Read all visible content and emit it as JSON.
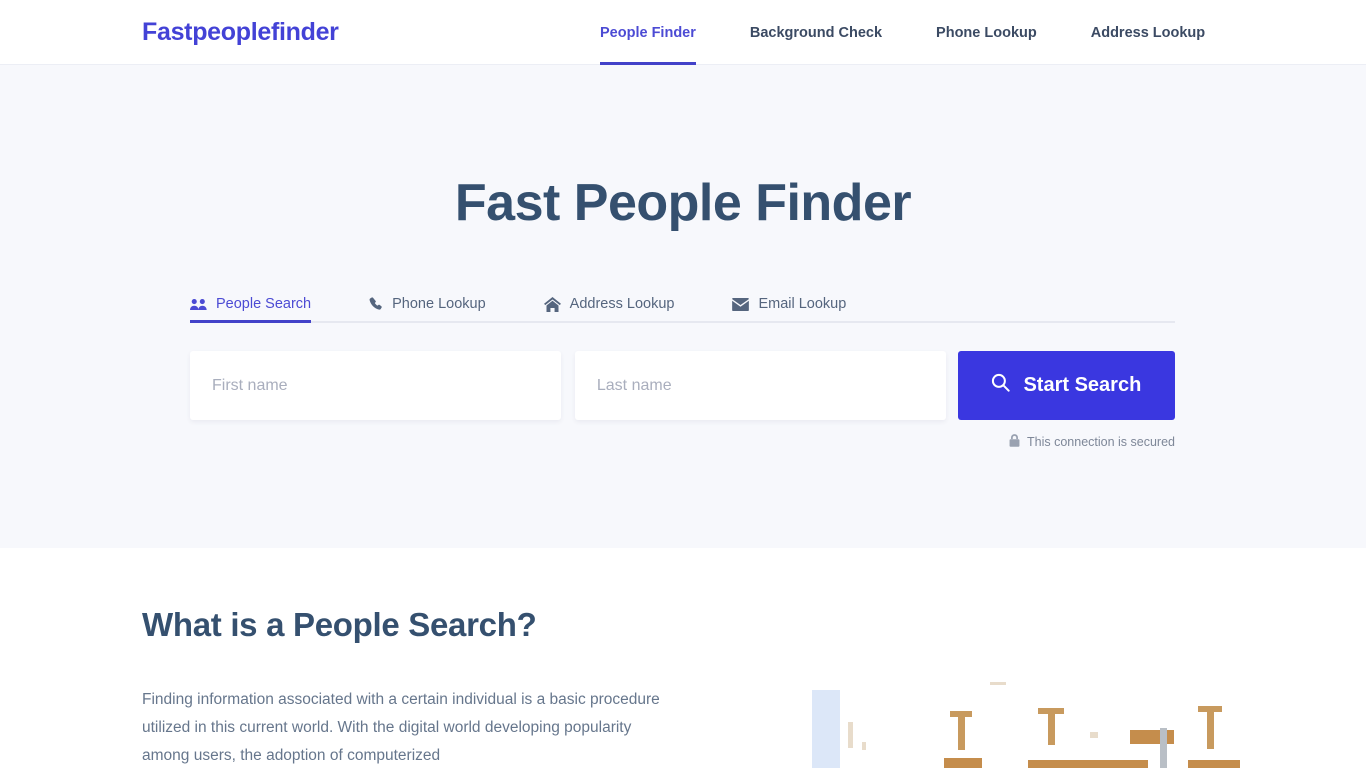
{
  "header": {
    "logo": "Fastpeoplefinder",
    "nav": [
      {
        "label": "People Finder",
        "active": true
      },
      {
        "label": "Background Check",
        "active": false
      },
      {
        "label": "Phone Lookup",
        "active": false
      },
      {
        "label": "Address Lookup",
        "active": false
      }
    ]
  },
  "hero": {
    "title": "Fast People Finder",
    "tabs": [
      {
        "label": "People Search",
        "icon": "users-icon",
        "active": true
      },
      {
        "label": "Phone Lookup",
        "icon": "phone-icon",
        "active": false
      },
      {
        "label": "Address Lookup",
        "icon": "home-icon",
        "active": false
      },
      {
        "label": "Email Lookup",
        "icon": "envelope-icon",
        "active": false
      }
    ],
    "search": {
      "first_name_placeholder": "First name",
      "first_name_value": "",
      "last_name_placeholder": "Last name",
      "last_name_value": "",
      "button_label": "Start Search",
      "button_icon": "search-icon",
      "secured_text": "This connection is secured",
      "secured_icon": "lock-icon"
    }
  },
  "content": {
    "section_title": "What is a People Search?",
    "section_body": "Finding information associated with a certain individual is a basic procedure utilized in this current world. With the digital world developing popularity among users, the adoption of computerized"
  },
  "colors": {
    "brand_purple": "#4342d6",
    "button_blue": "#3a37e0",
    "heading_slate": "#35506f",
    "hero_background": "#f7f8fc",
    "body_text": "#66768c"
  }
}
